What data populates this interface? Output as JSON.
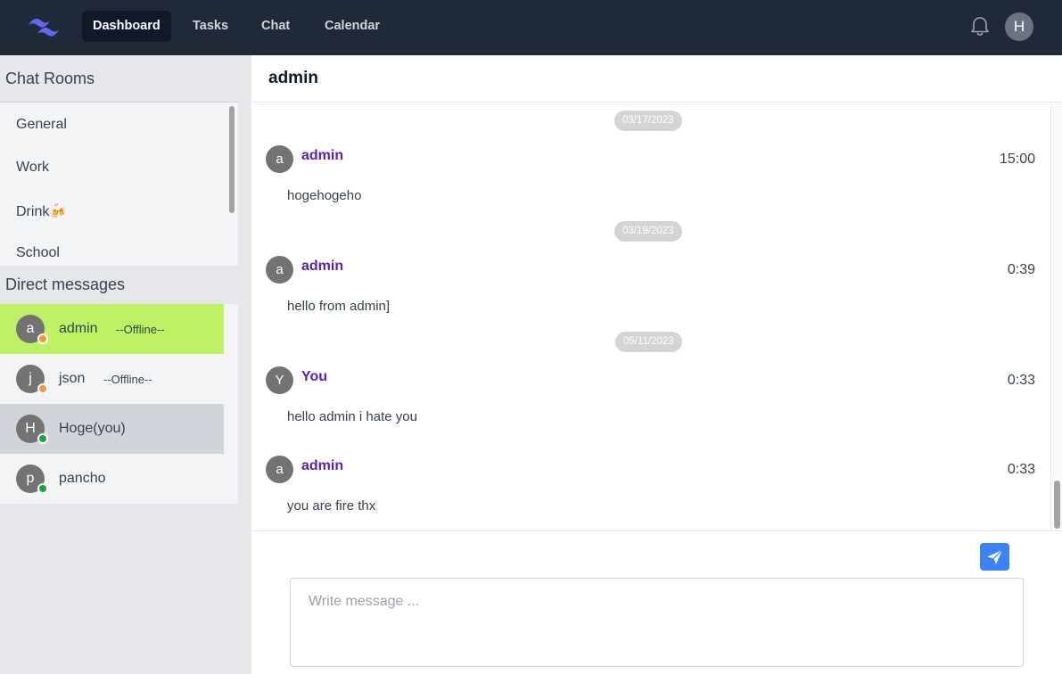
{
  "nav": {
    "logo_icon": "tailwind-logo",
    "items": [
      {
        "label": "Dashboard",
        "active": true
      },
      {
        "label": "Tasks",
        "active": false
      },
      {
        "label": "Chat",
        "active": false
      },
      {
        "label": "Calendar",
        "active": false
      }
    ],
    "notification_icon": "bell-icon",
    "user_initial": "H"
  },
  "sidebar": {
    "chat_rooms_title": "Chat Rooms",
    "rooms": [
      {
        "label": "General"
      },
      {
        "label": "Work"
      },
      {
        "label": "Drink🍻"
      },
      {
        "label": "School"
      }
    ],
    "dm_title": "Direct messages",
    "dms": [
      {
        "initial": "a",
        "name": "admin",
        "status": "--Offline--",
        "online": false,
        "selected": true
      },
      {
        "initial": "j",
        "name": "json",
        "status": "--Offline--",
        "online": false,
        "selected": false
      },
      {
        "initial": "H",
        "name": "Hoge(you)",
        "status": "",
        "online": true,
        "selected": false,
        "self": true
      },
      {
        "initial": "p",
        "name": "pancho",
        "status": "",
        "online": true,
        "selected": false
      }
    ]
  },
  "chat": {
    "title": "admin",
    "dates": [
      "03/17/2023",
      "03/19/2023",
      "05/11/2023"
    ],
    "messages": [
      {
        "initial": "a",
        "author": "admin",
        "time": "15:00",
        "text": "hogehogeho"
      },
      {
        "initial": "a",
        "author": "admin",
        "time": "0:39",
        "text": "hello from admin]"
      },
      {
        "initial": "Y",
        "author": "You",
        "time": "0:33",
        "text": "hello admin i hate you"
      },
      {
        "initial": "a",
        "author": "admin",
        "time": "0:33",
        "text": "you are fire thx"
      }
    ],
    "composer": {
      "value": "",
      "placeholder": "Write message ..."
    },
    "send_icon": "paper-plane-icon"
  },
  "colors": {
    "topbar": "#1f2937",
    "selected_dm": "#bef264",
    "author": "#5b21b6",
    "send_button": "#3b82f6",
    "offline_dot": "#fb923c",
    "online_dot": "#16a34a"
  }
}
